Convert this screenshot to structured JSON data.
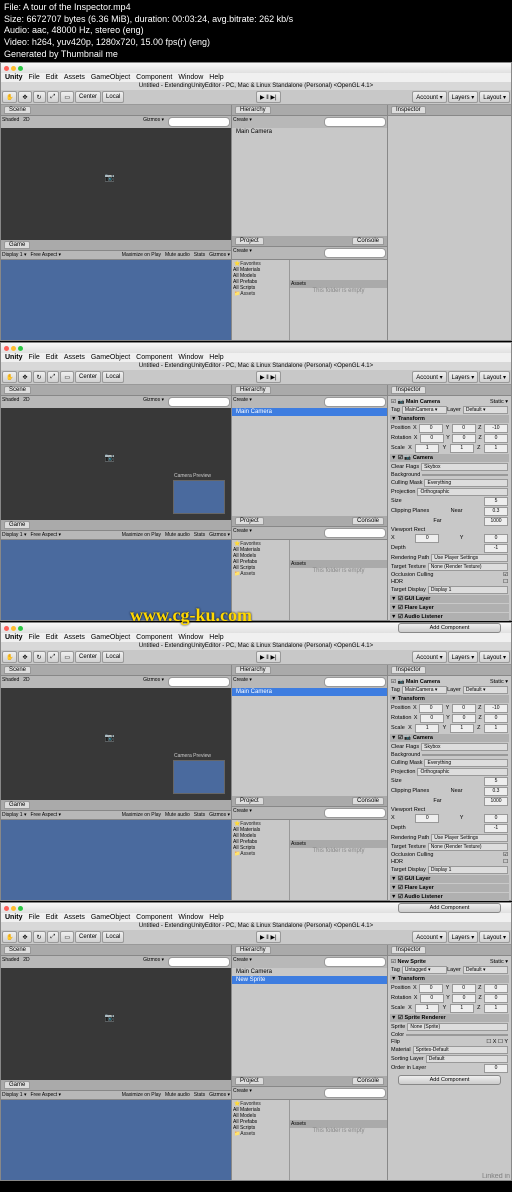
{
  "meta": {
    "file": "File: A tour of the Inspector.mp4",
    "size": "Size: 6672707 bytes (6.36 MiB), duration: 00:03:24, avg.bitrate: 262 kb/s",
    "audio": "Audio: aac, 48000 Hz, stereo (eng)",
    "video": "Video: h264, yuv420p, 1280x720, 15.00 fps(r) (eng)",
    "gen": "Generated by Thumbnail me"
  },
  "watermark": "www.cg-ku.com",
  "menus": [
    "Unity",
    "File",
    "Edit",
    "Assets",
    "GameObject",
    "Component",
    "Window",
    "Help"
  ],
  "title": "Untitled - ExtendingUnityEditor - PC, Mac & Linux Standalone (Personal) <OpenGL 4.1>",
  "toolbar": {
    "center": "▶ ‖ ▶|",
    "account": "Account ▾",
    "layers": "Layers ▾",
    "layout": "Layout ▾",
    "pivot": "Center",
    "local": "Local"
  },
  "tabs": {
    "scene": "Scene",
    "game": "Game",
    "hier": "Hierarchy",
    "proj": "Project",
    "cons": "Console",
    "insp": "Inspector"
  },
  "sceneBar": {
    "shaded": "Shaded",
    "d2": "2D",
    "giz": "Gizmos ▾"
  },
  "gameBar": {
    "disp": "Display 1 ▾",
    "asp": "Free Aspect ▾",
    "max": "Maximize on Play",
    "mute": "Mute audio",
    "stats": "Stats",
    "giz": "Gizmos ▾"
  },
  "hier": {
    "create": "Create ▾",
    "main": "Main Camera",
    "sprite": "New Sprite"
  },
  "proj": {
    "create": "Create ▾",
    "fav": "Favorites",
    "mat": "All Materials",
    "mod": "All Models",
    "pre": "All Prefabs",
    "scr": "All Scripts",
    "assets": "Assets",
    "empty": "This folder is empty"
  },
  "preview": "Camera Preview",
  "insp1": {
    "name": "Main Camera",
    "static": "Static ▾",
    "tag": "Tag",
    "tagv": "MainCamera ▾",
    "layer": "Layer",
    "layerv": "Default ▾",
    "transform": "Transform",
    "pos": "Position",
    "rot": "Rotation",
    "scale": "Scale",
    "x": "X",
    "y": "Y",
    "z": "Z",
    "camera": "Camera",
    "clearflags": "Clear Flags",
    "skybox": "Skybox",
    "bg": "Background",
    "culling": "Culling Mask",
    "every": "Everything",
    "projection": "Projection",
    "ortho": "Orthographic",
    "size": "Size",
    "clip": "Clipping Planes",
    "near": "Near",
    "far": "Far",
    "nearv": "0.3",
    "farv": "1000",
    "viewport": "Viewport Rect",
    "depth": "Depth",
    "render": "Rendering Path",
    "usepl": "Use Player Settings",
    "target": "Target Texture",
    "none": "None (Render Texture)",
    "occ": "Occlusion Culling",
    "hdr": "HDR",
    "tdisp": "Target Display",
    "d1": "Display 1",
    "gui": "GUI Layer",
    "flare": "Flare Layer",
    "audio": "Audio Listener",
    "add": "Add Component",
    "v0": "0",
    "v1": "1",
    "v10": "-10",
    "v5": "5"
  },
  "insp2": {
    "name": "New Sprite",
    "renderer": "Sprite Renderer",
    "sprite": "Sprite",
    "nones": "None (Sprite)",
    "color": "Color",
    "flip": "Flip",
    "material": "Material",
    "sdef": "Sprites-Default",
    "sortl": "Sorting Layer",
    "def": "Default",
    "order": "Order in Layer"
  },
  "linkedin": "Linked in"
}
